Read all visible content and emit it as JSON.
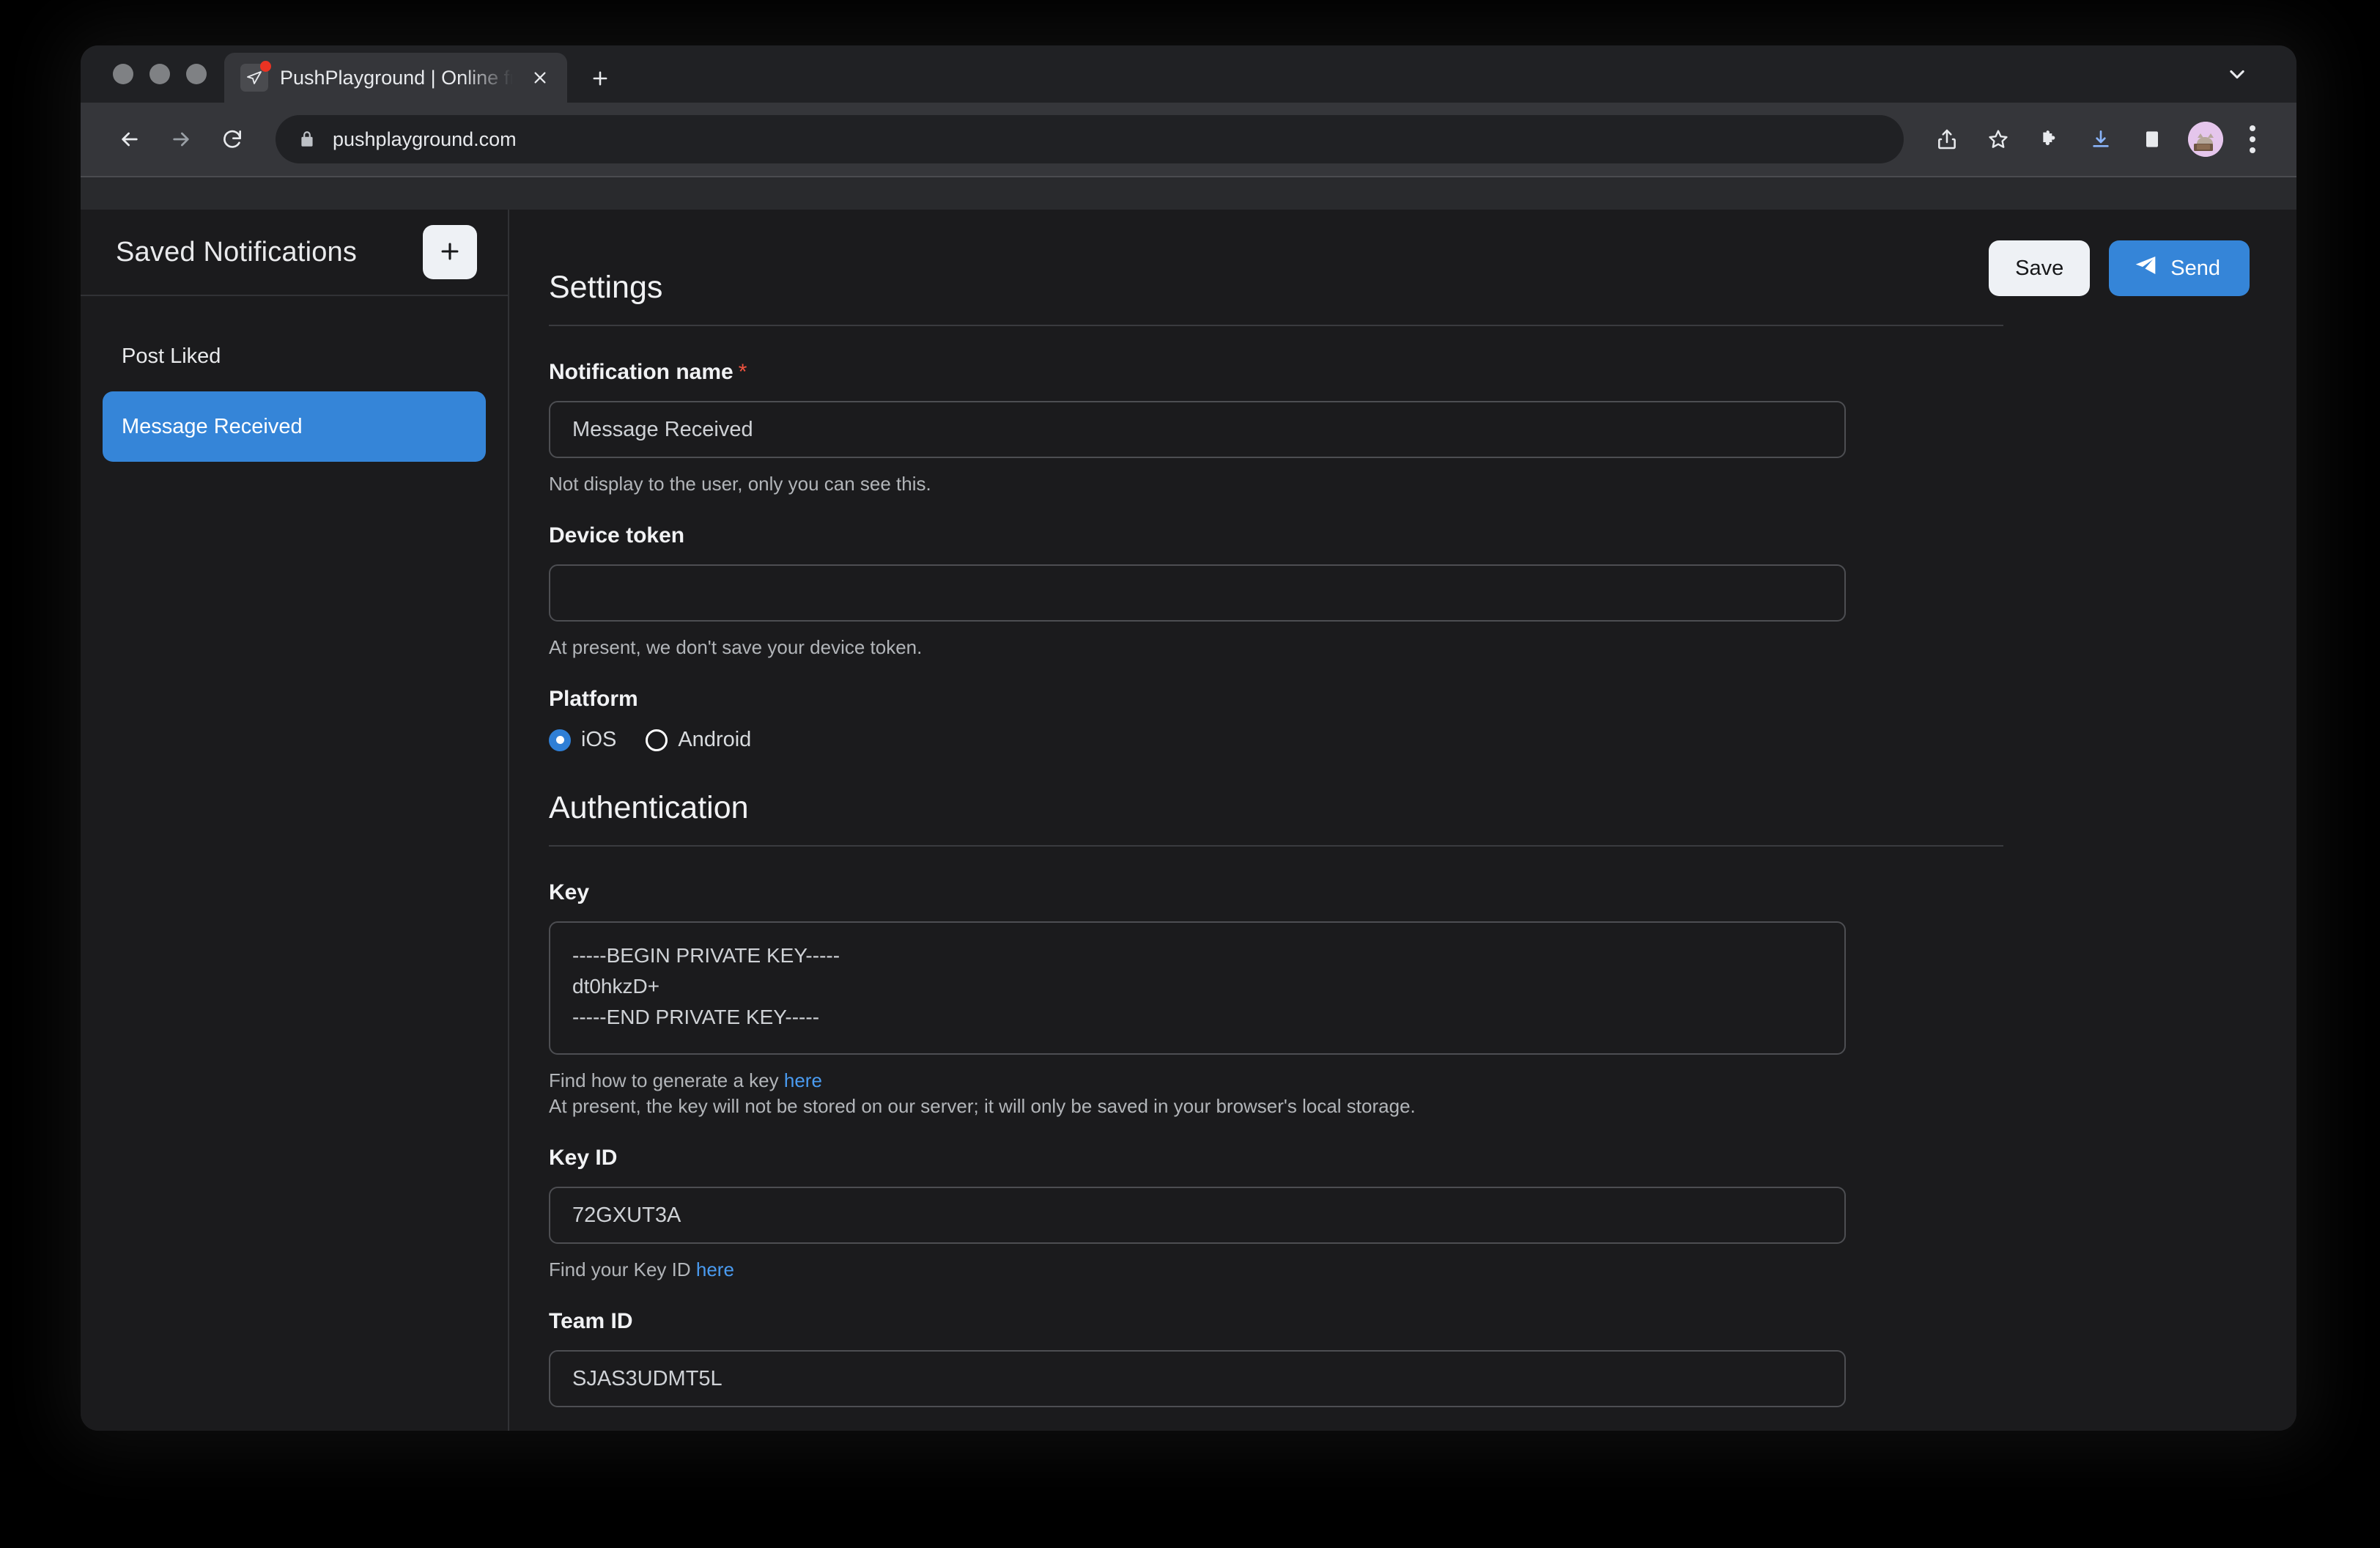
{
  "browser": {
    "tab": {
      "title": "PushPlayground | Online free A",
      "favicon_icon": "paper-plane-icon",
      "badge_color": "#ea3323",
      "close_icon": "close-icon"
    },
    "new_tab_icon": "plus-icon",
    "tab_search_icon": "chevron-down-icon",
    "nav": {
      "back_icon": "back-arrow-icon",
      "forward_icon": "forward-arrow-icon",
      "reload_icon": "reload-icon"
    },
    "omnibox": {
      "lock_icon": "lock-icon",
      "url": "pushplayground.com"
    },
    "actions": {
      "share_icon": "share-icon",
      "bookmark_icon": "star-icon",
      "extensions_icon": "puzzle-icon",
      "downloads_icon": "download-icon",
      "side_panel_icon": "side-panel-icon",
      "profile_icon": "avatar",
      "menu_icon": "kebab-menu-icon"
    }
  },
  "sidebar": {
    "title": "Saved Notifications",
    "add_icon": "plus-icon",
    "items": [
      {
        "label": "Post Liked",
        "active": false
      },
      {
        "label": "Message Received",
        "active": true
      }
    ]
  },
  "toolbar": {
    "save_label": "Save",
    "send_label": "Send",
    "send_icon": "paper-plane-icon"
  },
  "settings": {
    "heading": "Settings",
    "notification_name": {
      "label": "Notification name",
      "required_marker": "*",
      "value": "Message Received",
      "helper": "Not display to the user, only you can see this."
    },
    "device_token": {
      "label": "Device token",
      "value": "",
      "helper": "At present, we don't save your device token."
    },
    "platform": {
      "label": "Platform",
      "options": [
        {
          "label": "iOS",
          "selected": true
        },
        {
          "label": "Android",
          "selected": false
        }
      ]
    }
  },
  "authentication": {
    "heading": "Authentication",
    "key": {
      "label": "Key",
      "value": "-----BEGIN PRIVATE KEY-----\ndt0hkzD+\n-----END PRIVATE KEY-----",
      "helper_prefix": "Find how to generate a key ",
      "helper_link": "here",
      "helper_note": "At present, the key will not be stored on our server; it will only be saved in your browser's local storage.",
      "resize_icon": "resize-grip-icon"
    },
    "key_id": {
      "label": "Key ID",
      "value": "72GXUT3A",
      "helper_prefix": "Find your Key ID ",
      "helper_link": "here"
    },
    "team_id": {
      "label": "Team ID",
      "value": "SJAS3UDMT5L"
    }
  },
  "colors": {
    "accent": "#3585d8",
    "required": "#f0533f",
    "link": "#4a9bf0",
    "page_bg": "#1b1b1d"
  }
}
